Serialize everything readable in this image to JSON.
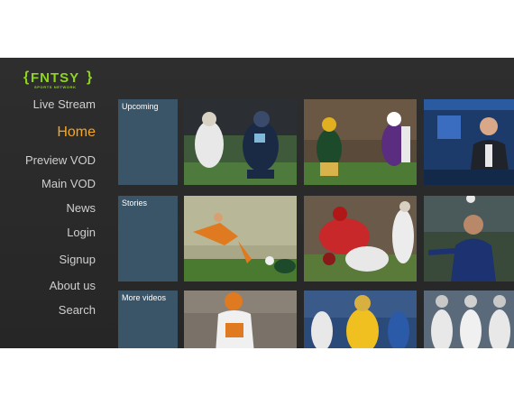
{
  "logo": {
    "name": "FNTSY",
    "tagline": "SPORTS NETWORK"
  },
  "menu": [
    {
      "label": "Live Stream"
    },
    {
      "label": "Home",
      "active": true
    },
    {
      "label": "Preview VOD"
    },
    {
      "label": "Main VOD"
    },
    {
      "label": "News"
    },
    {
      "label": "Login"
    },
    {
      "label": "Signup"
    },
    {
      "label": "About us"
    },
    {
      "label": "Search"
    }
  ],
  "rows": [
    {
      "label": "Upcoming"
    },
    {
      "label": "Stories"
    },
    {
      "label": "More videos"
    }
  ],
  "colors": {
    "accent": "#f5a623",
    "brand": "#8ed61e",
    "row_label_bg": "#3b5568"
  }
}
